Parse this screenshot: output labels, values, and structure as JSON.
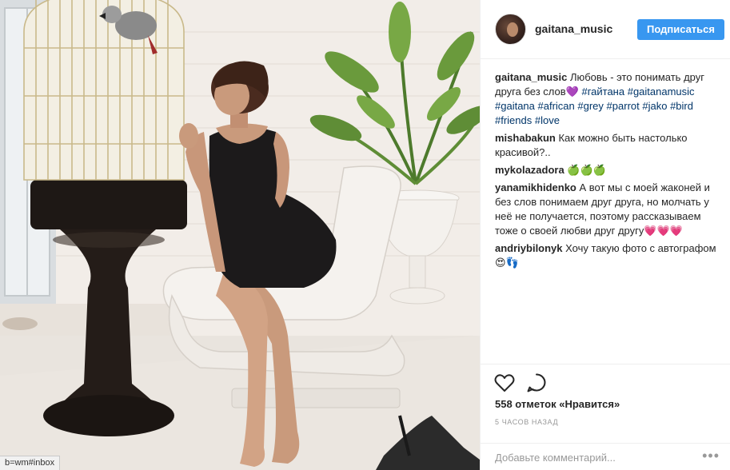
{
  "status_bar": {
    "link_text": "b=wm#inbox"
  },
  "header": {
    "username": "gaitana_music",
    "follow_label": "Подписаться",
    "avatar_icon": "profile-photo"
  },
  "comments": [
    {
      "user": "gaitana_music",
      "text": "Любовь - это понимать друг друга без слов",
      "emoji": "💜",
      "hashtags": [
        "#гайтана",
        "#gaitanamusic",
        "#gaitana",
        "#african",
        "#grey",
        "#parrot",
        "#jako",
        "#bird",
        "#friends",
        "#love"
      ]
    },
    {
      "user": "mishabakun",
      "text": "Как можно быть настолько красивой?..",
      "emoji": ""
    },
    {
      "user": "mykolazadora",
      "text": "",
      "emoji": "🍏🍏🍏"
    },
    {
      "user": "yanamikhidenko",
      "text": "А вот мы с моей жаконей и без слов понимаем друг друга, но молчать у неё не получается, поэтому рассказываем тоже о своей любви друг другу",
      "emoji": "💗💗💗"
    },
    {
      "user": "andriybilonyk",
      "text": "Хочу такую фото с автографом",
      "emoji": "😍👣"
    }
  ],
  "actions": {
    "like_icon": "heart-outline-icon",
    "comment_icon": "speech-bubble-icon",
    "likes": "558 отметок «Нравится»",
    "time": "5 часов назад"
  },
  "add_comment": {
    "placeholder": "Добавьте комментарий...",
    "more_label": "•••"
  },
  "colors": {
    "accent": "#3897f0",
    "hashtag": "#003569",
    "muted": "#999999",
    "border": "#efefef"
  }
}
